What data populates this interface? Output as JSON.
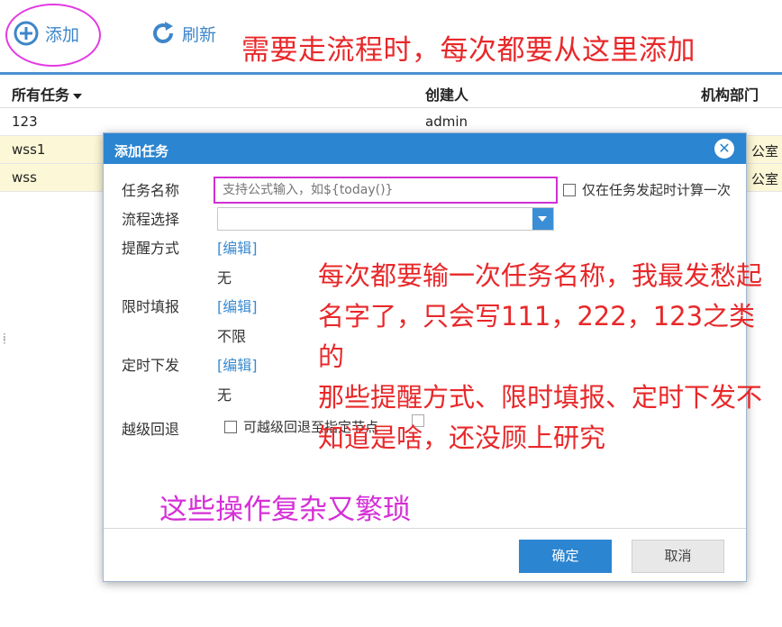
{
  "toolbar": {
    "add_label": "添加",
    "refresh_label": "刷新",
    "annotation_top": "需要走流程时，每次都要从这里添加"
  },
  "grid": {
    "columns": [
      "所有任务",
      "创建人",
      "机构部门"
    ],
    "rows": [
      {
        "task": "123",
        "creator": "admin",
        "dept": ""
      },
      {
        "task": "wss1",
        "creator": "",
        "dept": "公室"
      },
      {
        "task": "wss",
        "creator": "",
        "dept": "公室"
      }
    ]
  },
  "dialog": {
    "title": "添加任务",
    "close_glyph": "✕",
    "fields": {
      "task_name_label": "任务名称",
      "task_name_placeholder": "支持公式输入，如${today()}",
      "compute_once_label": "仅在任务发起时计算一次",
      "flow_select_label": "流程选择",
      "flow_select_value": "",
      "remind_label": "提醒方式",
      "remind_edit": "[编辑]",
      "remind_value": "无",
      "deadline_label": "限时填报",
      "deadline_edit": "[编辑]",
      "deadline_value": "不限",
      "schedule_label": "定时下发",
      "schedule_edit": "[编辑]",
      "schedule_value": "无",
      "skip_label": "越级回退",
      "skip_option": "可越级回退至指定节点"
    },
    "annotation_mid": "每次都要输一次任务名称，我最发愁起名字了，只会写111，222，123之类的\n那些提醒方式、限时填报、定时下发不知道是啥，还没顾上研究",
    "annotation_purple": "这些操作复杂又繁琐",
    "ok_label": "确定",
    "cancel_label": "取消"
  },
  "colors": {
    "accent": "#2b85d1",
    "annotation_red": "#e8282a",
    "annotation_purple": "#d52fd7",
    "row_highlight": "#fcf8d7"
  },
  "icons": {
    "add": "plus-circle-icon",
    "refresh": "refresh-icon",
    "close": "close-icon",
    "dropdown": "chevron-down-icon"
  }
}
